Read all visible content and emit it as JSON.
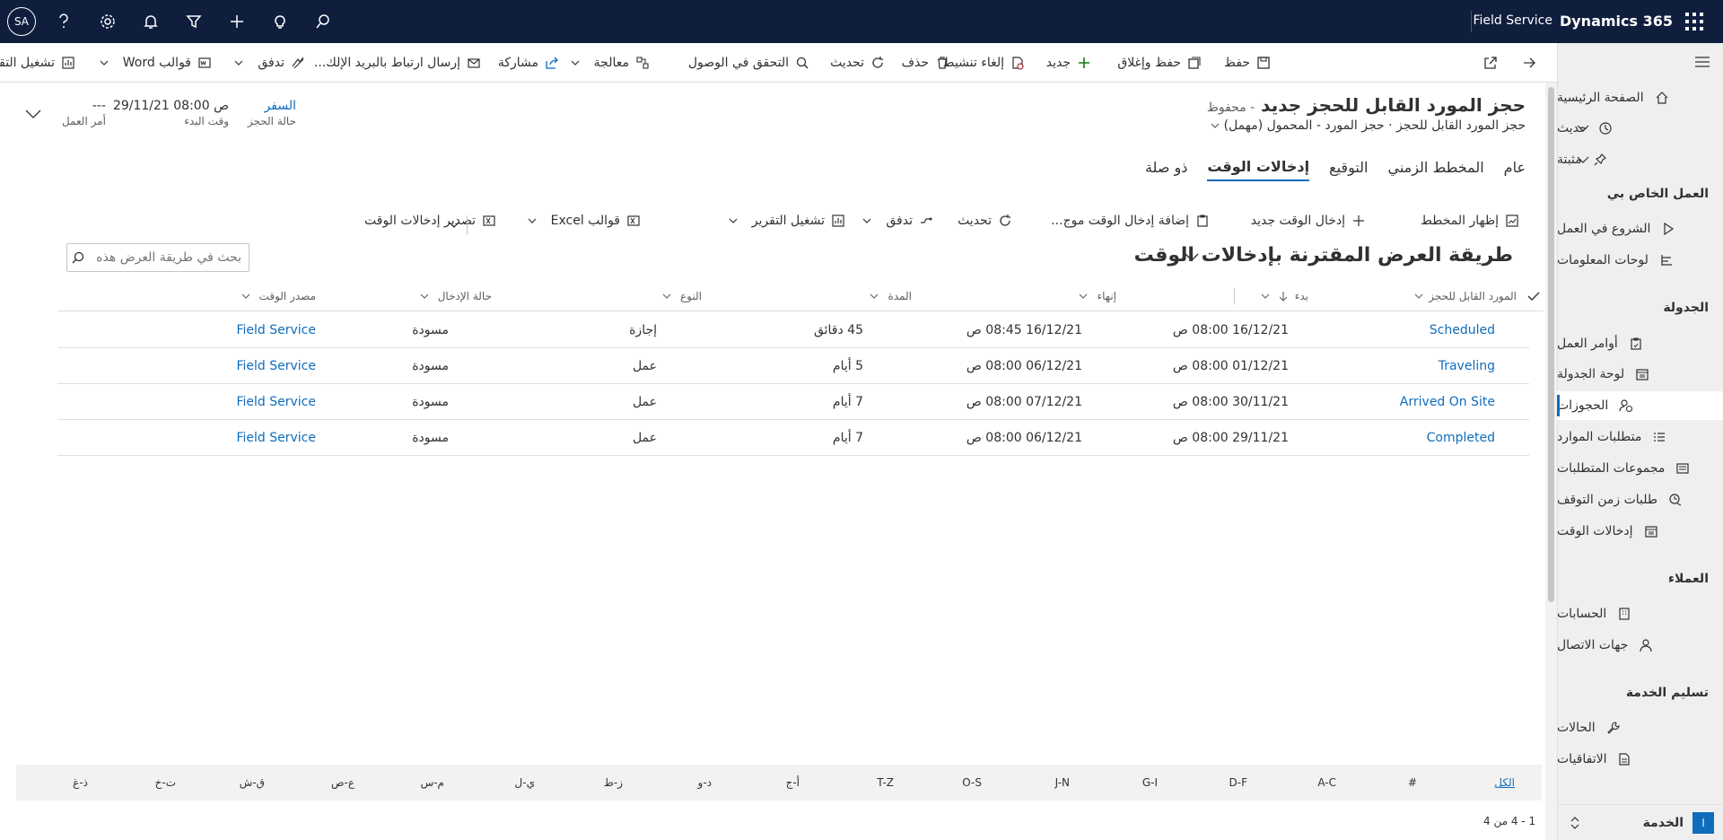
{
  "topbar": {
    "brand": "Dynamics 365",
    "app_name": "Field Service",
    "avatar_initials": "SA"
  },
  "sidebar": {
    "home": "الصفحة الرئيسية",
    "recent": "حديث",
    "pinned": "مثبتة",
    "section_my_work": "العمل الخاص بي",
    "get_started": "الشروع في العمل",
    "dashboards": "لوحات المعلومات",
    "section_schedule": "الجدولة",
    "work_orders": "أوامر العمل",
    "schedule_board": "لوحة الجدولة",
    "bookings": "الحجوزات",
    "requirements": "متطلبات الموارد",
    "requirement_groups": "مجموعات المتطلبات",
    "time_off_requests": "طلبات زمن التوقف",
    "time_entries": "إدخالات الوقت",
    "section_customers": "العملاء",
    "accounts": "الحسابات",
    "contacts": "جهات الاتصال",
    "section_service_delivery": "تسليم الخدمة",
    "cases": "الحالات",
    "agreements": "الاتفاقيات",
    "area_badge": "ا",
    "area_label": "الخدمة"
  },
  "commandbar": {
    "save": "حفظ",
    "save_close": "حفظ وإغلاق",
    "new": "جديد",
    "deactivate": "إلغاء تنشيط",
    "delete": "حذف",
    "refresh": "تحديث",
    "check_access": "التحقق في الوصول",
    "process": "معالجة",
    "share": "مشاركة",
    "email_link": "إرسال ارتباط بالبريد الإلك...",
    "flow": "تدفق",
    "word_templates": "قوالب Word",
    "run_report": "تشغيل التقرير"
  },
  "record": {
    "title": "حجز المورد القابل للحجز جديد",
    "saved_status": "- محفوظ",
    "entity": "حجز المورد القابل للحجز",
    "form_name": "حجز المورد - المحمول (مهمل)",
    "booking_status_value": "السفر",
    "booking_status_label": "حالة الحجز",
    "start_time_value": "29/11/21 08:00 ص",
    "start_time_label": "وقت البدء",
    "work_order_value": "---",
    "work_order_label": "أمر العمل"
  },
  "tabs": [
    "عام",
    "المخطط الزمني",
    "التوقيع",
    "إدخالات الوقت",
    "ذو صلة"
  ],
  "subgrid_commands": {
    "show_chart": "إظهار المخطط",
    "new_time_entry": "إدخال الوقت جديد",
    "add_existing": "إضافة إدخال الوقت موج...",
    "refresh": "تحديث",
    "flow": "تدفق",
    "run_report": "تشغيل التقرير",
    "excel_templates": "قوالب Excel",
    "export": "تصدير إدخالات الوقت"
  },
  "view": {
    "title": "طريقة العرض المقترنة بإدخالات الوقت",
    "search_placeholder": "بحث في طريقة العرض هذه"
  },
  "columns": [
    "المورد القابل للحجز",
    "بدء",
    "إنهاء",
    "المدة",
    "النوع",
    "حالة الإدخال",
    "مصدر الوقت"
  ],
  "rows": [
    {
      "resource": "Scheduled",
      "start": "16/12/21 08:00 ص",
      "end": "16/12/21 08:45 ص",
      "duration": "45 دقائق",
      "type": "إجازة",
      "status": "مسودة",
      "source": "Field Service"
    },
    {
      "resource": "Traveling",
      "start": "01/12/21 08:00 ص",
      "end": "06/12/21 08:00 ص",
      "duration": "5 أيام",
      "type": "عمل",
      "status": "مسودة",
      "source": "Field Service"
    },
    {
      "resource": "Arrived On Site",
      "start": "30/11/21 08:00 ص",
      "end": "07/12/21 08:00 ص",
      "duration": "7 أيام",
      "type": "عمل",
      "status": "مسودة",
      "source": "Field Service"
    },
    {
      "resource": "Completed",
      "start": "29/11/21 08:00 ص",
      "end": "06/12/21 08:00 ص",
      "duration": "7 أيام",
      "type": "عمل",
      "status": "مسودة",
      "source": "Field Service"
    }
  ],
  "alpha_filter": [
    "الكل",
    "#",
    "A-C",
    "D-F",
    "G-I",
    "J-N",
    "O-S",
    "T-Z",
    "أ-ج",
    "د-و",
    "ز-ط",
    "ي-ل",
    "م-س",
    "ع-ص",
    "ق-ش",
    "ت-خ",
    "ذ-غ"
  ],
  "footer": {
    "count": "1 - 4 من 4"
  },
  "colors": {
    "topbar": "#0f1e3d",
    "accent": "#0f6cbd",
    "sidebar": "#efefef"
  }
}
